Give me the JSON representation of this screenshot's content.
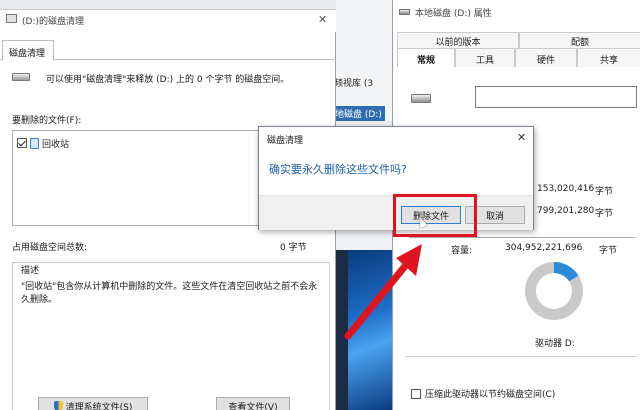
{
  "background": {
    "label_view_library": "频视库 (3",
    "label_local_disk": "地磁盘 (D:)"
  },
  "disk_cleanup": {
    "window_title": "(D:)的磁盘清理",
    "tab": "磁盘清理",
    "description": "可以使用\"磁盘清理\"来释放 (D:) 上的 0 个字节 的磁盘空间。",
    "files_label": "要删除的文件(F):",
    "items": [
      {
        "label": "回收站",
        "checked": true
      }
    ],
    "total_label": "占用磁盘空间总数:",
    "total_value": "0 字节",
    "group_title": "描述",
    "group_text": "\"回收站\"包含你从计算机中删除的文件。这些文件在清空回收站之前不会永久删除。",
    "clean_system_button": "清理系统文件(S)",
    "view_files_button": "查看文件(V)"
  },
  "properties": {
    "window_title": "本地磁盘 (D:) 属性",
    "tabs_row1": [
      "以前的版本",
      "配额"
    ],
    "tabs_row2": [
      "常规",
      "工具",
      "硬件",
      "共享"
    ],
    "active_tab": "常规",
    "used_value": "153,020,416",
    "free_value": "799,201,280",
    "capacity_label": "容量:",
    "capacity_value": "304,952,221,696",
    "unit": "字节",
    "used_fraction": 0.16,
    "drive_label": "驱动器 D:",
    "compress_label": "压缩此驱动器以节约磁盘空间(C)",
    "compress_checked": false
  },
  "dialog": {
    "title": "磁盘清理",
    "message": "确实要永久删除这些文件吗?",
    "delete_button": "删除文件",
    "cancel_button": "取消"
  },
  "colors": {
    "highlight": "#e0141e",
    "accent": "#2a8ad8",
    "message": "#1c5fa8"
  }
}
